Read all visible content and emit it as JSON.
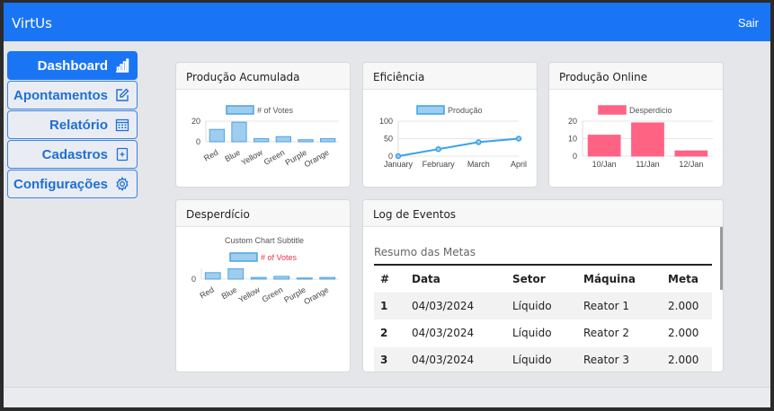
{
  "app": {
    "brand": "VirtUs",
    "logout": "Sair"
  },
  "sidebar": {
    "items": [
      {
        "label": "Dashboard",
        "icon": "bar-chart-icon",
        "active": true
      },
      {
        "label": "Apontamentos",
        "icon": "edit-icon",
        "active": false
      },
      {
        "label": "Relatório",
        "icon": "calendar-icon",
        "active": false
      },
      {
        "label": "Cadastros",
        "icon": "add-file-icon",
        "active": false
      },
      {
        "label": "Configurações",
        "icon": "gear-icon",
        "active": false
      }
    ]
  },
  "cards": {
    "producao_acumulada": "Produção Acumulada",
    "eficiencia": "Eficiência",
    "producao_online": "Produção Online",
    "desperdicio": "Desperdício",
    "log": "Log de Eventos"
  },
  "log": {
    "subtitle": "Resumo das Metas",
    "headers": [
      "#",
      "Data",
      "Setor",
      "Máquina",
      "Meta"
    ],
    "rows": [
      [
        "1",
        "04/03/2024",
        "Líquido",
        "Reator 1",
        "2.000"
      ],
      [
        "2",
        "04/03/2024",
        "Líquido",
        "Reator 2",
        "2.000"
      ],
      [
        "3",
        "04/03/2024",
        "Líquido",
        "Reator 3",
        "2.000"
      ]
    ]
  },
  "colors": {
    "primary": "#1a75f5",
    "bar_blue": "#9fcdef",
    "bar_blue_border": "#4ea3e0",
    "bar_red": "#ff6384",
    "line_blue": "#36a2eb",
    "legend_red_text": "#e8354f"
  },
  "chart_data": [
    {
      "type": "bar",
      "title": "",
      "categories": [
        "Red",
        "Blue",
        "Yellow",
        "Green",
        "Purple",
        "Orange"
      ],
      "series": [
        {
          "name": "# of Votes",
          "values": [
            12,
            19,
            3,
            5,
            2,
            3
          ]
        }
      ],
      "yticks": [
        "0",
        "20"
      ],
      "ylim": [
        0,
        20
      ],
      "legend": "top"
    },
    {
      "type": "line",
      "title": "",
      "categories": [
        "January",
        "February",
        "March",
        "April"
      ],
      "series": [
        {
          "name": "Produção",
          "values": [
            0,
            20,
            40,
            50
          ]
        }
      ],
      "yticks": [
        "0",
        "50",
        "100"
      ],
      "ylim": [
        0,
        100
      ],
      "legend": "top"
    },
    {
      "type": "bar",
      "title": "",
      "categories": [
        "10/Jan",
        "11/Jan",
        "12/Jan"
      ],
      "series": [
        {
          "name": "Desperdicio",
          "values": [
            12,
            19,
            3
          ]
        }
      ],
      "yticks": [
        "0",
        "10",
        "20"
      ],
      "ylim": [
        0,
        20
      ],
      "legend": "top"
    },
    {
      "type": "bar",
      "title": "",
      "subtitle": "Custom Chart Subtitle",
      "categories": [
        "Red",
        "Blue",
        "Yellow",
        "Green",
        "Purple",
        "Orange"
      ],
      "series": [
        {
          "name": "# of Votes",
          "values": [
            12,
            19,
            3,
            5,
            2,
            3
          ]
        }
      ],
      "yticks": [
        "0"
      ],
      "ylim": [
        0,
        20
      ],
      "legend": "top"
    }
  ]
}
